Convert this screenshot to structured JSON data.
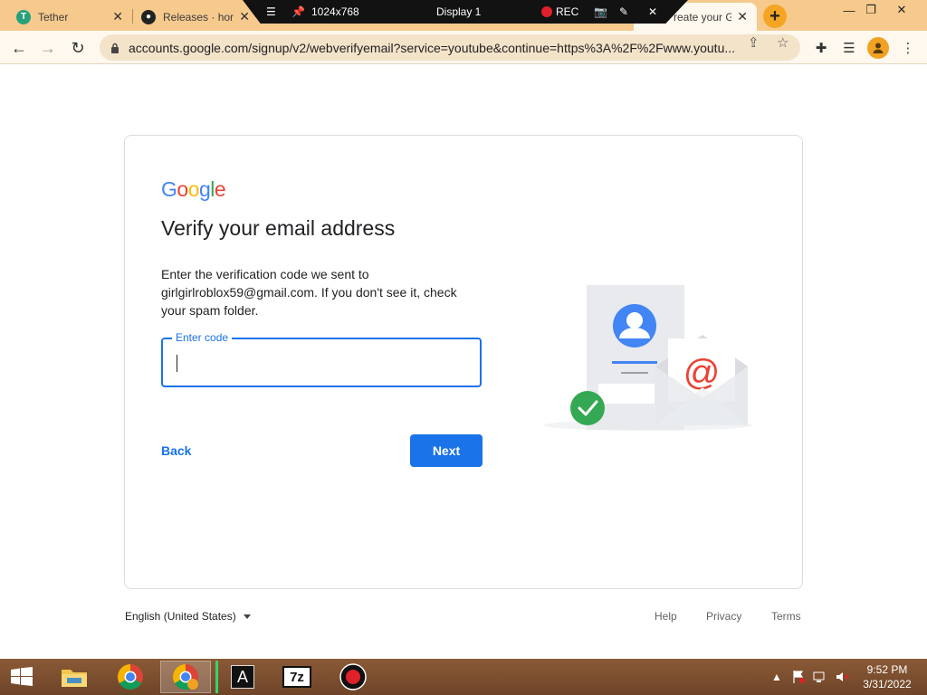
{
  "browser": {
    "tabs": [
      {
        "label": "Tether"
      },
      {
        "label": "Releases · hor"
      },
      {
        "label": "reate your G"
      }
    ],
    "new_tab": "+",
    "url": "accounts.google.com/signup/v2/webverifyemail?service=youtube&continue=https%3A%2F%2Fwww.youtu..."
  },
  "recorder": {
    "resolution": "1024x768",
    "display": "Display 1",
    "rec": "REC"
  },
  "page": {
    "logo_text": "Google",
    "heading": "Verify your email address",
    "description": "Enter the verification code we sent to girlgirlroblox59@gmail.com. If you don't see it, check your spam folder.",
    "code_label": "Enter code",
    "code_value": "",
    "back": "Back",
    "next": "Next"
  },
  "footer": {
    "language": "English (United States)",
    "help": "Help",
    "privacy": "Privacy",
    "terms": "Terms"
  },
  "taskbar": {
    "time": "9:52 PM",
    "date": "3/31/2022"
  }
}
